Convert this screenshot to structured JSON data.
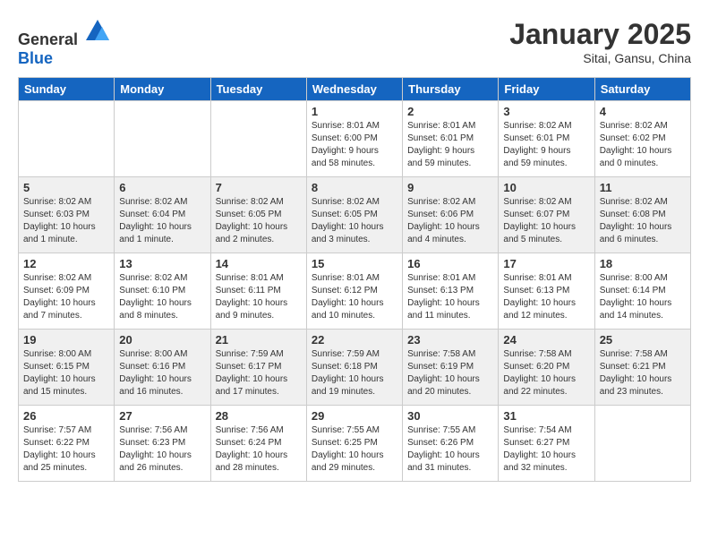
{
  "header": {
    "logo_general": "General",
    "logo_blue": "Blue",
    "month": "January 2025",
    "location": "Sitai, Gansu, China"
  },
  "weekdays": [
    "Sunday",
    "Monday",
    "Tuesday",
    "Wednesday",
    "Thursday",
    "Friday",
    "Saturday"
  ],
  "weeks": [
    [
      {
        "day": "",
        "info": ""
      },
      {
        "day": "",
        "info": ""
      },
      {
        "day": "",
        "info": ""
      },
      {
        "day": "1",
        "info": "Sunrise: 8:01 AM\nSunset: 6:00 PM\nDaylight: 9 hours\nand 58 minutes."
      },
      {
        "day": "2",
        "info": "Sunrise: 8:01 AM\nSunset: 6:01 PM\nDaylight: 9 hours\nand 59 minutes."
      },
      {
        "day": "3",
        "info": "Sunrise: 8:02 AM\nSunset: 6:01 PM\nDaylight: 9 hours\nand 59 minutes."
      },
      {
        "day": "4",
        "info": "Sunrise: 8:02 AM\nSunset: 6:02 PM\nDaylight: 10 hours\nand 0 minutes."
      }
    ],
    [
      {
        "day": "5",
        "info": "Sunrise: 8:02 AM\nSunset: 6:03 PM\nDaylight: 10 hours\nand 1 minute."
      },
      {
        "day": "6",
        "info": "Sunrise: 8:02 AM\nSunset: 6:04 PM\nDaylight: 10 hours\nand 1 minute."
      },
      {
        "day": "7",
        "info": "Sunrise: 8:02 AM\nSunset: 6:05 PM\nDaylight: 10 hours\nand 2 minutes."
      },
      {
        "day": "8",
        "info": "Sunrise: 8:02 AM\nSunset: 6:05 PM\nDaylight: 10 hours\nand 3 minutes."
      },
      {
        "day": "9",
        "info": "Sunrise: 8:02 AM\nSunset: 6:06 PM\nDaylight: 10 hours\nand 4 minutes."
      },
      {
        "day": "10",
        "info": "Sunrise: 8:02 AM\nSunset: 6:07 PM\nDaylight: 10 hours\nand 5 minutes."
      },
      {
        "day": "11",
        "info": "Sunrise: 8:02 AM\nSunset: 6:08 PM\nDaylight: 10 hours\nand 6 minutes."
      }
    ],
    [
      {
        "day": "12",
        "info": "Sunrise: 8:02 AM\nSunset: 6:09 PM\nDaylight: 10 hours\nand 7 minutes."
      },
      {
        "day": "13",
        "info": "Sunrise: 8:02 AM\nSunset: 6:10 PM\nDaylight: 10 hours\nand 8 minutes."
      },
      {
        "day": "14",
        "info": "Sunrise: 8:01 AM\nSunset: 6:11 PM\nDaylight: 10 hours\nand 9 minutes."
      },
      {
        "day": "15",
        "info": "Sunrise: 8:01 AM\nSunset: 6:12 PM\nDaylight: 10 hours\nand 10 minutes."
      },
      {
        "day": "16",
        "info": "Sunrise: 8:01 AM\nSunset: 6:13 PM\nDaylight: 10 hours\nand 11 minutes."
      },
      {
        "day": "17",
        "info": "Sunrise: 8:01 AM\nSunset: 6:13 PM\nDaylight: 10 hours\nand 12 minutes."
      },
      {
        "day": "18",
        "info": "Sunrise: 8:00 AM\nSunset: 6:14 PM\nDaylight: 10 hours\nand 14 minutes."
      }
    ],
    [
      {
        "day": "19",
        "info": "Sunrise: 8:00 AM\nSunset: 6:15 PM\nDaylight: 10 hours\nand 15 minutes."
      },
      {
        "day": "20",
        "info": "Sunrise: 8:00 AM\nSunset: 6:16 PM\nDaylight: 10 hours\nand 16 minutes."
      },
      {
        "day": "21",
        "info": "Sunrise: 7:59 AM\nSunset: 6:17 PM\nDaylight: 10 hours\nand 17 minutes."
      },
      {
        "day": "22",
        "info": "Sunrise: 7:59 AM\nSunset: 6:18 PM\nDaylight: 10 hours\nand 19 minutes."
      },
      {
        "day": "23",
        "info": "Sunrise: 7:58 AM\nSunset: 6:19 PM\nDaylight: 10 hours\nand 20 minutes."
      },
      {
        "day": "24",
        "info": "Sunrise: 7:58 AM\nSunset: 6:20 PM\nDaylight: 10 hours\nand 22 minutes."
      },
      {
        "day": "25",
        "info": "Sunrise: 7:58 AM\nSunset: 6:21 PM\nDaylight: 10 hours\nand 23 minutes."
      }
    ],
    [
      {
        "day": "26",
        "info": "Sunrise: 7:57 AM\nSunset: 6:22 PM\nDaylight: 10 hours\nand 25 minutes."
      },
      {
        "day": "27",
        "info": "Sunrise: 7:56 AM\nSunset: 6:23 PM\nDaylight: 10 hours\nand 26 minutes."
      },
      {
        "day": "28",
        "info": "Sunrise: 7:56 AM\nSunset: 6:24 PM\nDaylight: 10 hours\nand 28 minutes."
      },
      {
        "day": "29",
        "info": "Sunrise: 7:55 AM\nSunset: 6:25 PM\nDaylight: 10 hours\nand 29 minutes."
      },
      {
        "day": "30",
        "info": "Sunrise: 7:55 AM\nSunset: 6:26 PM\nDaylight: 10 hours\nand 31 minutes."
      },
      {
        "day": "31",
        "info": "Sunrise: 7:54 AM\nSunset: 6:27 PM\nDaylight: 10 hours\nand 32 minutes."
      },
      {
        "day": "",
        "info": ""
      }
    ]
  ]
}
